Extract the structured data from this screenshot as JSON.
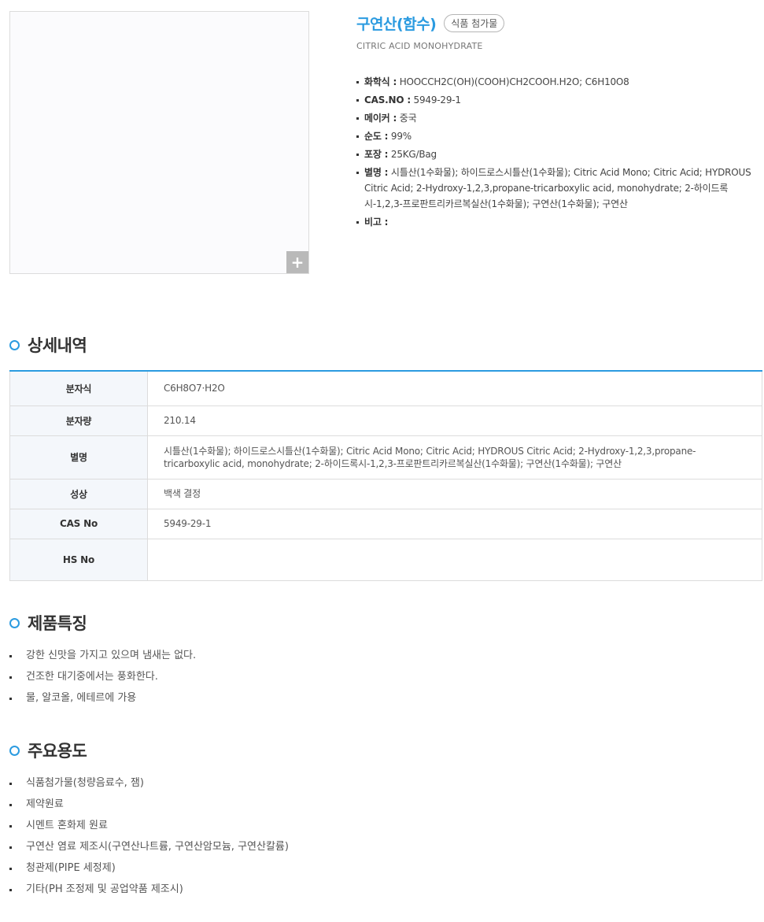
{
  "product": {
    "name": "구연산(함수)",
    "category": "식품 첨가물",
    "english_name": "CITRIC ACID MONOHYDRATE",
    "zoom_label": "+",
    "specs": [
      {
        "label": "화학식 :",
        "value": "HOOCCH2C(OH)(COOH)CH2COOH.H2O; C6H10O8"
      },
      {
        "label": "CAS.NO :",
        "value": "5949-29-1"
      },
      {
        "label": "메이커 :",
        "value": "중국"
      },
      {
        "label": "순도 :",
        "value": "99%"
      },
      {
        "label": "포장 :",
        "value": "25KG/Bag"
      },
      {
        "label": "별명 :",
        "value": "시틀산(1수화물); 하이드로스시틀산(1수화물); Citric Acid Mono; Citric Acid; HYDROUS Citric Acid; 2-Hydroxy-1,2,3,propane-tricarboxylic acid, monohydrate; 2-하이드록시-1,2,3-프로판트리카르복실산(1수화물); 구연산(1수화물); 구연산"
      },
      {
        "label": "비고 :",
        "value": ""
      }
    ]
  },
  "detail": {
    "title": "상세내역",
    "rows": [
      {
        "label": "분자식",
        "value": "C6H8O7·H2O"
      },
      {
        "label": "분자량",
        "value": "210.14"
      },
      {
        "label": "별명",
        "value": "시틀산(1수화물); 하이드로스시틀산(1수화물); Citric Acid Mono; Citric Acid; HYDROUS Citric Acid; 2-Hydroxy-1,2,3,propane-tricarboxylic acid, monohydrate; 2-하이드록시-1,2,3-프로판트리카르복실산(1수화물); 구연산(1수화물); 구연산"
      },
      {
        "label": "성상",
        "value": "백색 결정"
      },
      {
        "label": "CAS No",
        "value": "5949-29-1"
      },
      {
        "label": "HS No",
        "value": ""
      }
    ]
  },
  "features": {
    "title": "제품특징",
    "items": [
      "강한 신맛을 가지고 있으며 냄새는 없다.",
      "건조한 대기중에서는 풍화한다.",
      "물, 알코올, 에테르에 가용"
    ]
  },
  "uses": {
    "title": "주요용도",
    "items": [
      "식품첨가물(청량음료수, 잼)",
      "제약원료",
      "시멘트 혼화제 원료",
      "구연산 염료 제조시(구연산나트륨, 구연산암모늄, 구연산칼륨)",
      "청관제(PIPE 세정제)",
      "기타(PH 조정제 및 공업약품 제조시)"
    ]
  }
}
